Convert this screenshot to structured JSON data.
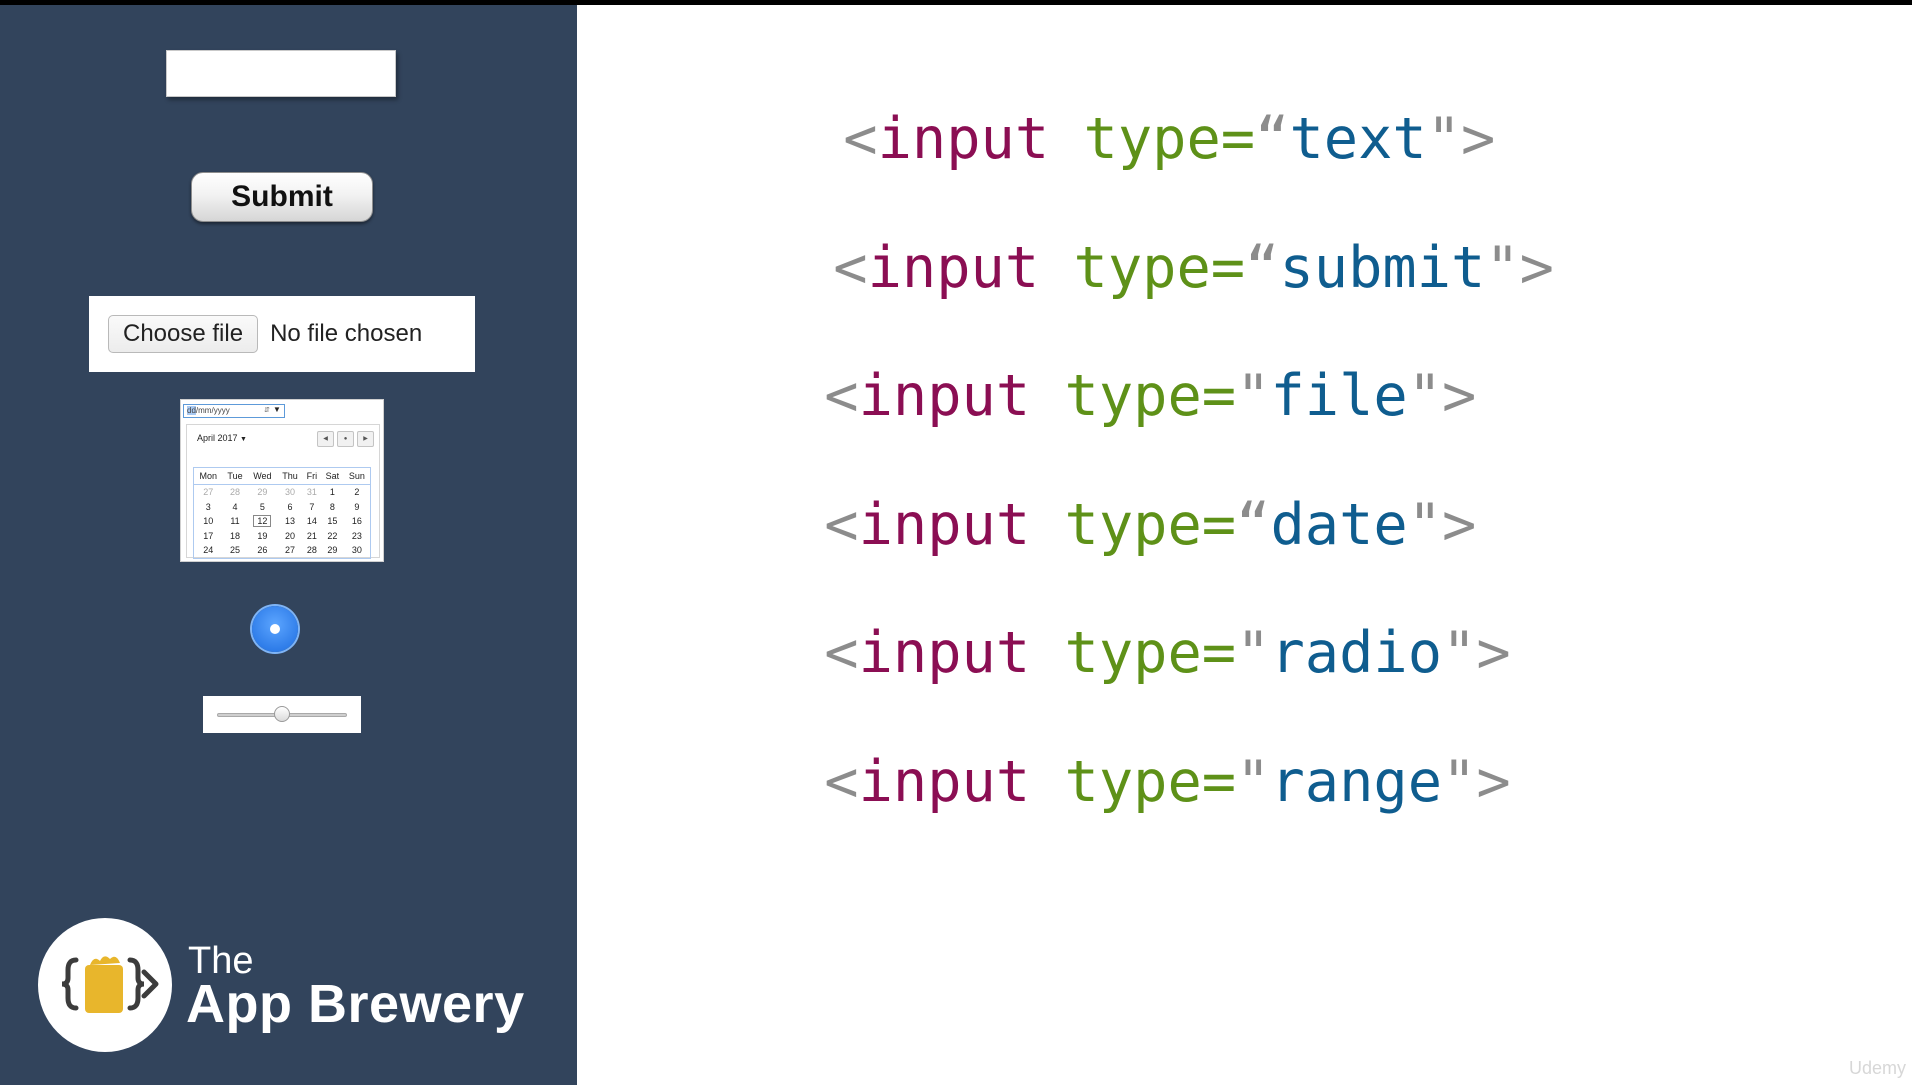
{
  "sidebar": {
    "submit_label": "Submit",
    "file_button_label": "Choose file",
    "file_status": "No file chosen",
    "date_field": {
      "dd": "dd",
      "mm": "mm",
      "yyyy": "yyyy",
      "sep": "/"
    },
    "range_value": 0.5,
    "radio_checked": true,
    "brand_the": "The",
    "brand_name": "App Brewery"
  },
  "calendar": {
    "month_label": "April 2017",
    "weekdays": [
      "Mon",
      "Tue",
      "Wed",
      "Thu",
      "Fri",
      "Sat",
      "Sun"
    ],
    "weeks": [
      [
        "27",
        "28",
        "29",
        "30",
        "31",
        "1",
        "2"
      ],
      [
        "3",
        "4",
        "5",
        "6",
        "7",
        "8",
        "9"
      ],
      [
        "10",
        "11",
        "12",
        "13",
        "14",
        "15",
        "16"
      ],
      [
        "17",
        "18",
        "19",
        "20",
        "21",
        "22",
        "23"
      ],
      [
        "24",
        "25",
        "26",
        "27",
        "28",
        "29",
        "30"
      ]
    ],
    "muted_first_row_count": 5,
    "today": "12"
  },
  "code_lines": [
    {
      "tag": "<input",
      "attr": "type=",
      "open_quote": "“",
      "value": "text",
      "close": "\">"
    },
    {
      "tag": "<input",
      "attr": "type=",
      "open_quote": "“",
      "value": "submit",
      "close": "\">"
    },
    {
      "tag": "<input",
      "attr": "type=",
      "open_quote": "\"",
      "value": "file",
      "close": "\">"
    },
    {
      "tag": "<input",
      "attr": "type=",
      "open_quote": "“",
      "value": "date",
      "close": "\">"
    },
    {
      "tag": "<input",
      "attr": "type=",
      "open_quote": "\"",
      "value": "radio",
      "close": "\">"
    },
    {
      "tag": "<input",
      "attr": "type=",
      "open_quote": "\"",
      "value": "range",
      "close": "\">"
    }
  ],
  "watermark": "Udemy",
  "colors": {
    "sidebar_bg": "#32445c",
    "tag": "#8b0e53",
    "attr": "#5e9118",
    "value": "#0f5d8f",
    "punct": "#8c8c8c"
  }
}
